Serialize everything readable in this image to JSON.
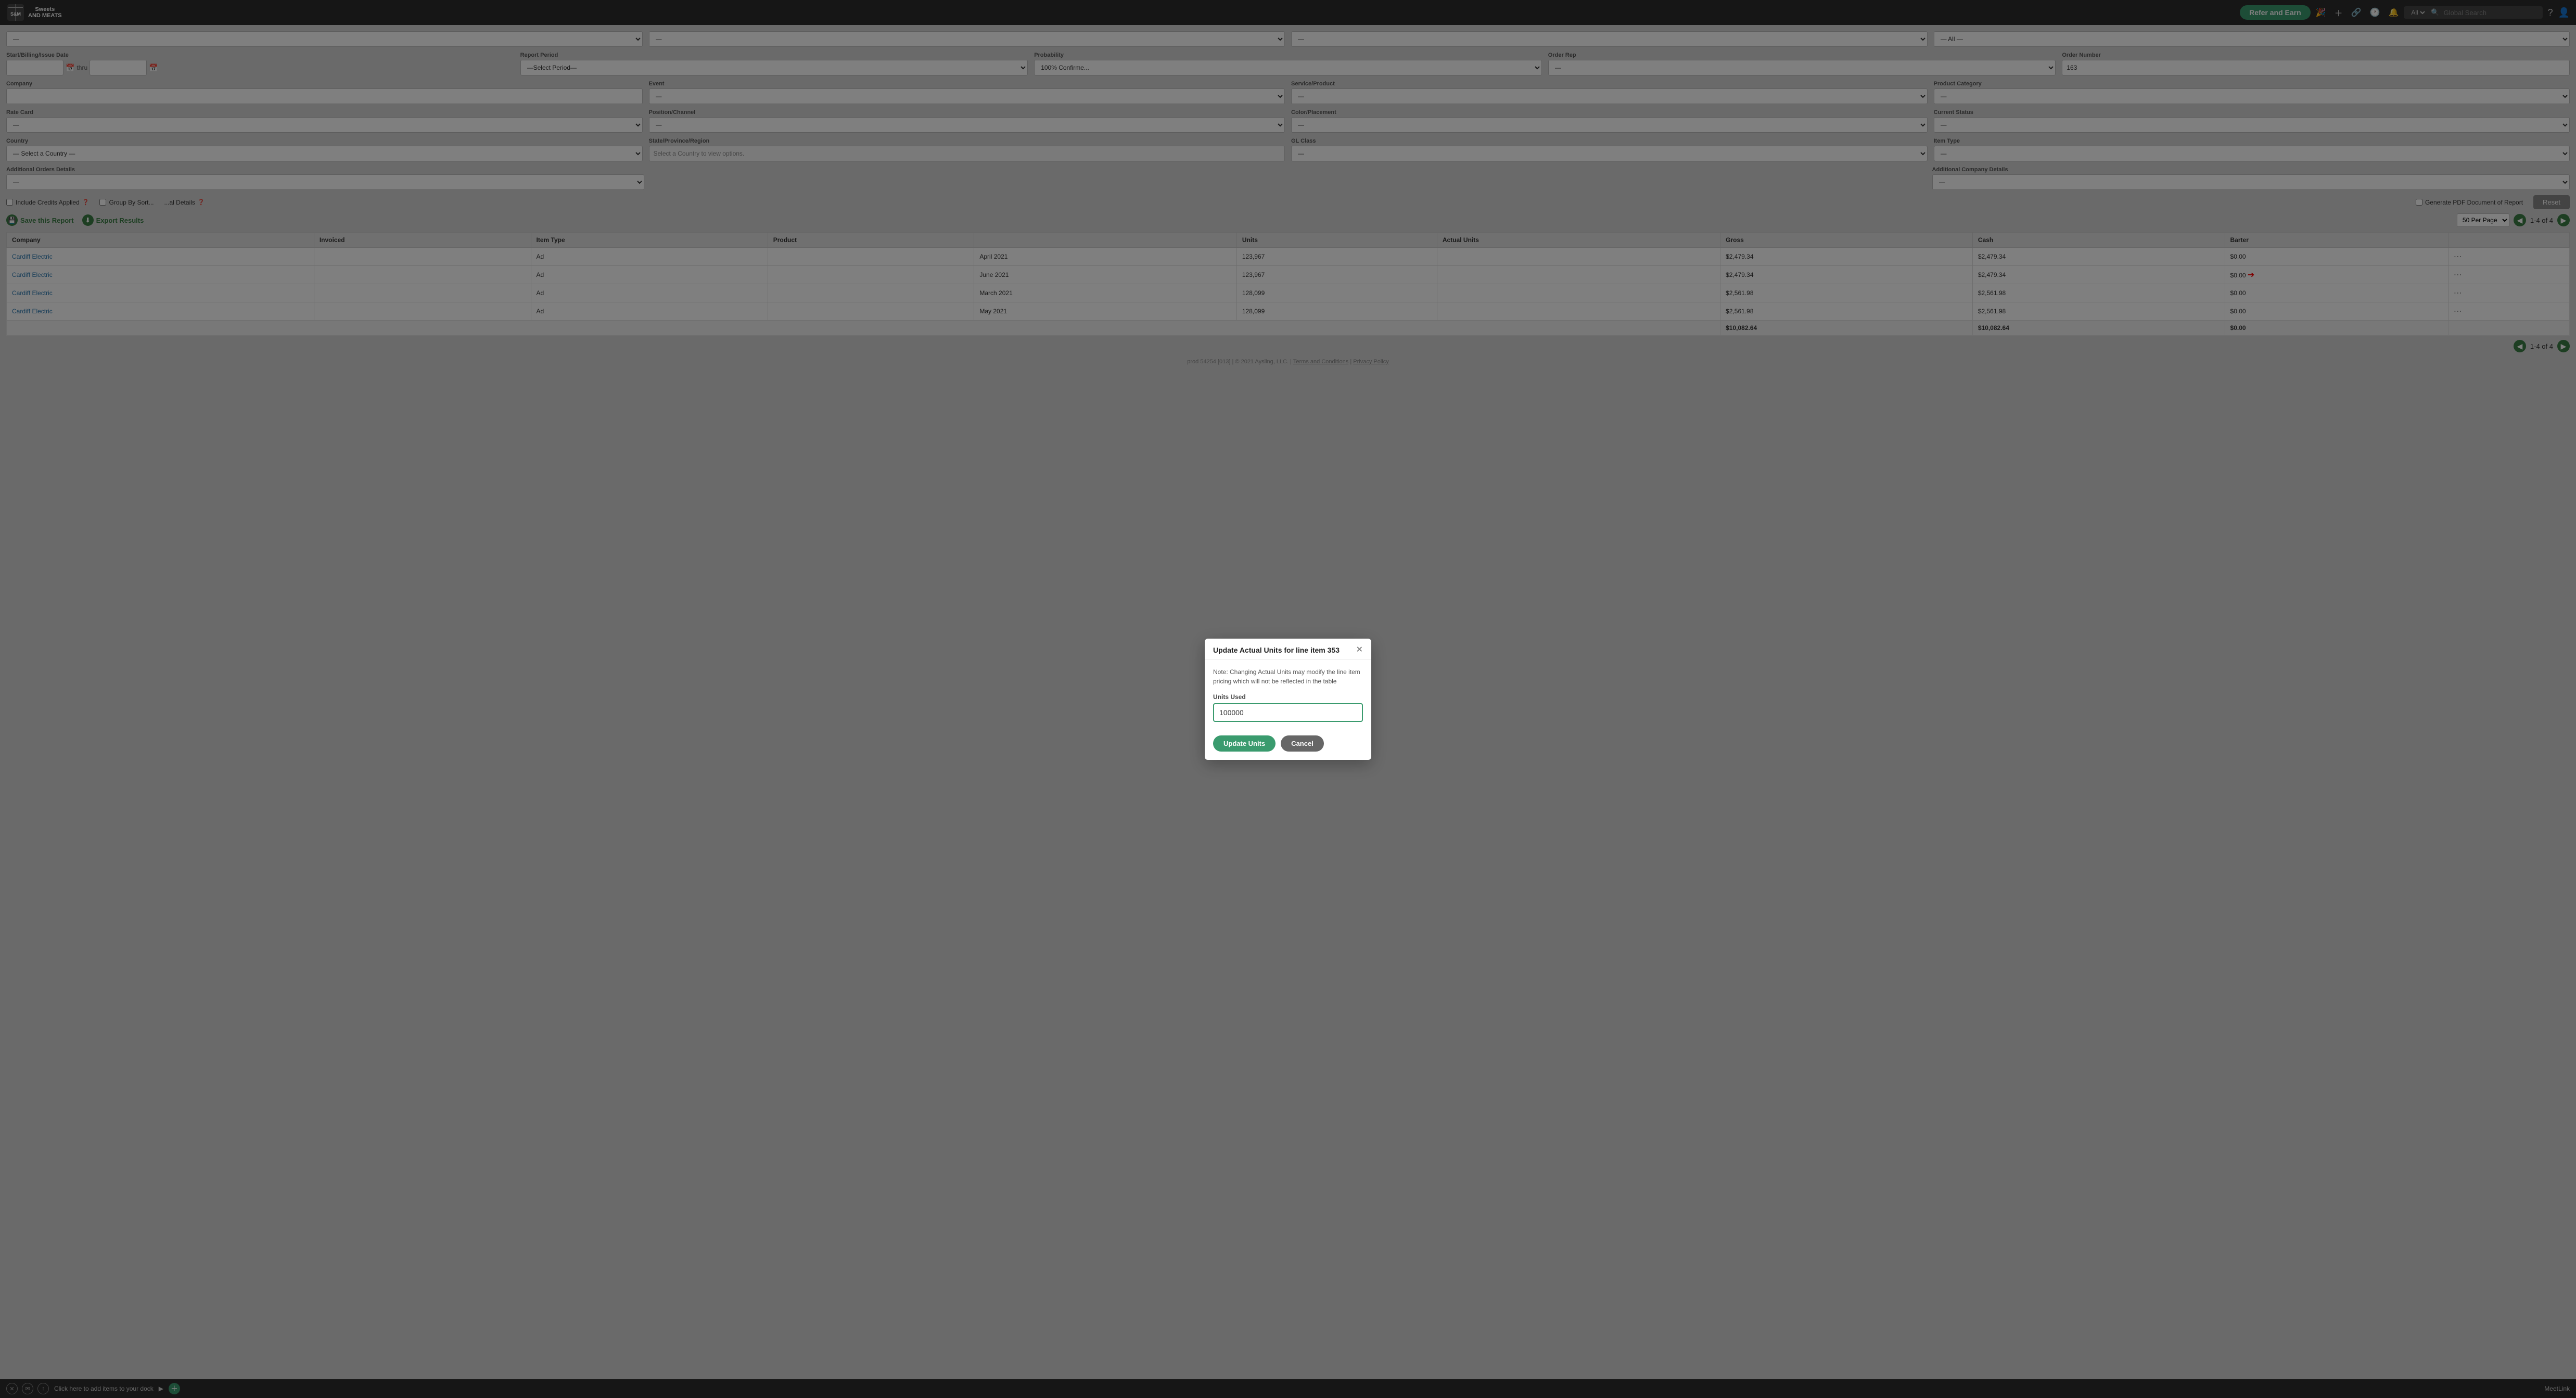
{
  "app": {
    "logo_line1": "Sweets",
    "logo_line2": "AND MEATS"
  },
  "topnav": {
    "refer_earn": "Refer and Earn",
    "search_placeholder": "Global Search",
    "search_all_label": "All"
  },
  "filters": {
    "row1": [
      {
        "id": "filter1",
        "value": "—",
        "type": "select"
      },
      {
        "id": "filter2",
        "value": "—",
        "type": "select"
      },
      {
        "id": "filter3",
        "value": "—",
        "type": "select"
      },
      {
        "id": "filter4",
        "value": "— All —",
        "type": "select"
      }
    ],
    "start_billing_label": "Start/Billing/Issue Date",
    "date_from": "",
    "date_thru": "thru",
    "date_to": "",
    "report_period_label": "Report Period",
    "report_period_placeholder": "—Select Period—",
    "probability_label": "Probability",
    "probability_value": "100% Confirme...",
    "order_rep_label": "Order Rep",
    "order_rep_value": "—",
    "order_number_label": "Order Number",
    "order_number_value": "163",
    "company_label": "Company",
    "company_value": "",
    "event_label": "Event",
    "event_value": "—",
    "service_product_label": "Service/Product",
    "service_product_value": "—",
    "product_category_label": "Product Category",
    "product_category_value": "—",
    "rate_card_label": "Rate Card",
    "rate_card_value": "—",
    "position_channel_label": "Position/Channel",
    "position_channel_value": "—",
    "color_placement_label": "Color/Placement",
    "color_placement_value": "—",
    "current_status_label": "Current Status",
    "current_status_value": "—",
    "country_label": "Country",
    "country_value": "— Select a Country —",
    "state_label": "State/Province/Region",
    "state_note": "Select a Country to view options.",
    "gl_class_label": "GL Class",
    "gl_class_value": "—",
    "item_type_label": "Item Type",
    "item_type_value": "—",
    "additional_orders_label": "Additional Orders Details",
    "additional_orders_value": "—",
    "additional_company_label": "Additional Company Details",
    "additional_company_value": "—",
    "include_credits_label": "Include Credits Applied",
    "group_by_sort_label": "Group By Sort...",
    "additional_details_label": "...al Details",
    "generate_pdf_label": "Generate PDF Document of Report"
  },
  "action_bar": {
    "save_report": "Save this Report",
    "export_results": "Export Results",
    "per_page_label": "50 Per Page",
    "page_info": "1-4 of 4",
    "page_info_bottom": "1-4 of 4"
  },
  "table": {
    "columns": [
      "Company",
      "Invoiced",
      "Item Type",
      "Product",
      "",
      "Units",
      "Actual Units",
      "Gross",
      "Cash",
      "Barter"
    ],
    "rows": [
      {
        "company": "Cardiff Electric",
        "invoiced": "",
        "item_type": "Ad",
        "product": "",
        "date": "April 2021",
        "units": "123,967",
        "actual_units": "",
        "gross": "$2,479.34",
        "cash": "$2,479.34",
        "barter": "$0.00",
        "has_arrow": false
      },
      {
        "company": "Cardiff Electric",
        "invoiced": "",
        "item_type": "Ad",
        "product": "",
        "date": "June 2021",
        "units": "123,967",
        "actual_units": "",
        "gross": "$2,479.34",
        "cash": "$2,479.34",
        "barter": "$0.00",
        "has_arrow": true
      },
      {
        "company": "Cardiff Electric",
        "invoiced": "",
        "item_type": "Ad",
        "product": "",
        "date": "March 2021",
        "units": "128,099",
        "actual_units": "",
        "gross": "$2,561.98",
        "cash": "$2,561.98",
        "barter": "$0.00",
        "has_arrow": false
      },
      {
        "company": "Cardiff Electric",
        "invoiced": "",
        "item_type": "Ad",
        "product": "",
        "date": "May 2021",
        "units": "128,099",
        "actual_units": "",
        "gross": "$2,561.98",
        "cash": "$2,561.98",
        "barter": "$0.00",
        "has_arrow": false
      }
    ],
    "total": {
      "gross": "$10,082.64",
      "cash": "$10,082.64",
      "barter": "$0.00"
    }
  },
  "modal": {
    "title": "Update Actual Units for line item 353",
    "note": "Note: Changing Actual Units may modify the line item pricing which will not be reflected in the table",
    "units_used_label": "Units Used",
    "units_used_value": "100000",
    "update_btn": "Update Units",
    "cancel_btn": "Cancel"
  },
  "footer": {
    "env": "prod 54254 [013]",
    "copyright": "© 2021 Aysling, LLC.",
    "terms": "Terms and Conditions",
    "privacy": "Privacy Policy"
  },
  "dock": {
    "text": "Click here to add items to your dock"
  }
}
